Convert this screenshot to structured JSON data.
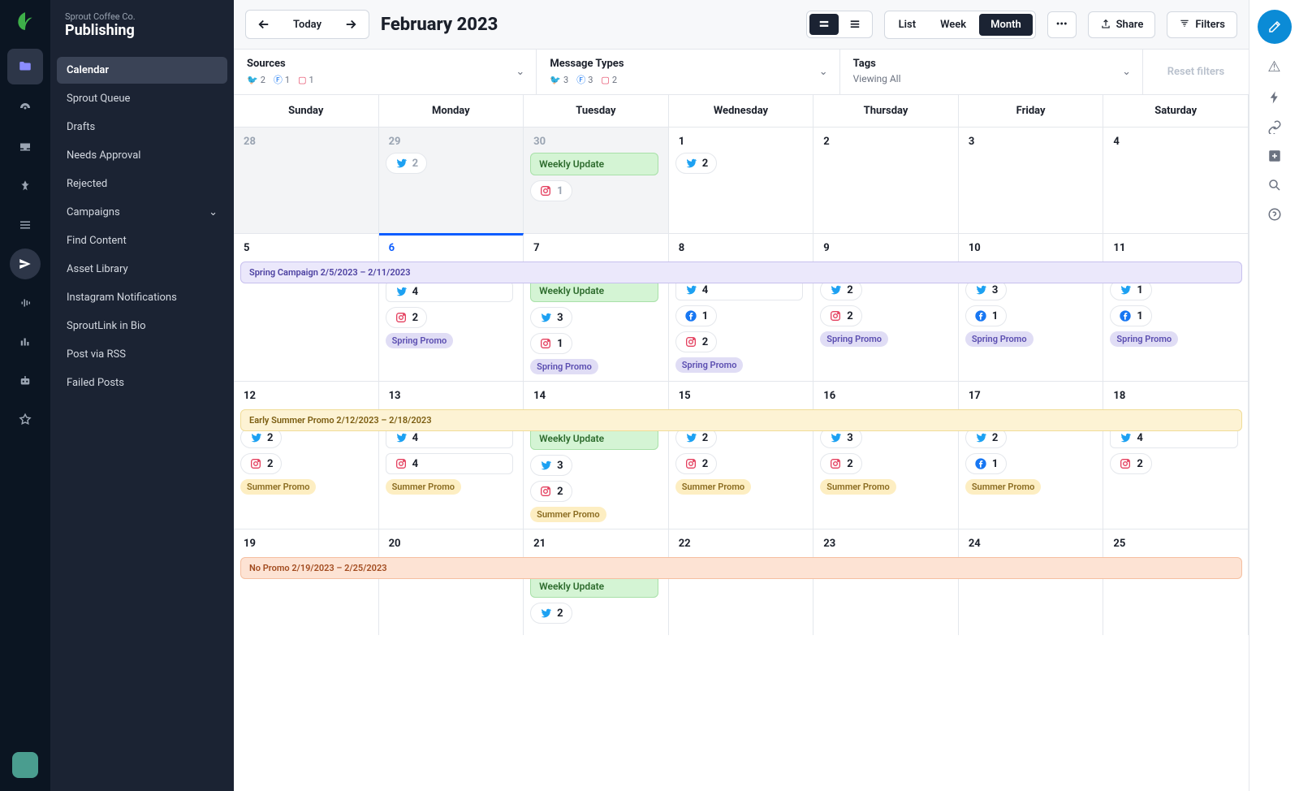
{
  "org": {
    "name": "Sprout Coffee Co.",
    "section": "Publishing"
  },
  "sidebar": {
    "items": [
      {
        "label": "Calendar",
        "active": true
      },
      {
        "label": "Sprout Queue"
      },
      {
        "label": "Drafts"
      },
      {
        "label": "Needs Approval"
      },
      {
        "label": "Rejected"
      },
      {
        "label": "Campaigns",
        "chevron": true
      },
      {
        "label": "Find Content"
      },
      {
        "label": "Asset Library"
      },
      {
        "label": "Instagram Notifications"
      },
      {
        "label": "SproutLink in Bio"
      },
      {
        "label": "Post via RSS"
      },
      {
        "label": "Failed Posts"
      }
    ]
  },
  "topbar": {
    "today": "Today",
    "title": "February 2023",
    "views": {
      "list": "List",
      "week": "Week",
      "month": "Month"
    },
    "share": "Share",
    "filters": "Filters"
  },
  "filters": {
    "sources": {
      "title": "Sources",
      "tw": "2",
      "fb": "1",
      "ig": "1"
    },
    "types": {
      "title": "Message Types",
      "tw": "3",
      "fb": "3",
      "ig": "2"
    },
    "tags": {
      "title": "Tags",
      "sub": "Viewing All"
    },
    "reset": "Reset filters"
  },
  "dow": [
    "Sunday",
    "Monday",
    "Tuesday",
    "Wednesday",
    "Thursday",
    "Friday",
    "Saturday"
  ],
  "labels": {
    "weekly": "Weekly Update",
    "spring": "Spring Promo",
    "summer": "Summer Promo"
  },
  "banners": {
    "w1": "Spring Campaign 2/5/2023 – 2/11/2023",
    "w2": "Early Summer Promo 2/12/2023 – 2/18/2023",
    "w3": "No Promo 2/19/2023 – 2/25/2023"
  },
  "weeks": [
    {
      "banner": null,
      "days": [
        {
          "num": "28",
          "prev": true
        },
        {
          "num": "29",
          "prev": true,
          "items": [
            {
              "t": "chip",
              "n": "tw",
              "v": "2"
            }
          ]
        },
        {
          "num": "30",
          "prev": true,
          "items": [
            {
              "t": "pill",
              "k": "weekly"
            },
            {
              "t": "chip",
              "n": "ig",
              "v": "1"
            }
          ]
        },
        {
          "num": "1",
          "items": [
            {
              "t": "chip",
              "n": "tw",
              "v": "2"
            }
          ]
        },
        {
          "num": "2"
        },
        {
          "num": "3"
        },
        {
          "num": "4"
        }
      ]
    },
    {
      "banner": "w1",
      "bclass": "purple",
      "days": [
        {
          "num": "5"
        },
        {
          "num": "6",
          "today": true,
          "items": [
            {
              "t": "chip",
              "n": "tw",
              "v": "4",
              "wide": true
            },
            {
              "t": "chip",
              "n": "ig",
              "v": "2"
            },
            {
              "t": "tag",
              "c": "purple",
              "k": "spring"
            }
          ]
        },
        {
          "num": "7",
          "items": [
            {
              "t": "pill",
              "k": "weekly"
            },
            {
              "t": "chip",
              "n": "tw",
              "v": "3"
            },
            {
              "t": "chip",
              "n": "ig",
              "v": "1"
            },
            {
              "t": "tag",
              "c": "purple",
              "k": "spring"
            }
          ]
        },
        {
          "num": "8",
          "items": [
            {
              "t": "chip",
              "n": "tw",
              "v": "4",
              "wide": true
            },
            {
              "t": "chip",
              "n": "fb",
              "v": "1"
            },
            {
              "t": "chip",
              "n": "ig",
              "v": "2"
            },
            {
              "t": "tag",
              "c": "purple",
              "k": "spring"
            }
          ]
        },
        {
          "num": "9",
          "items": [
            {
              "t": "chip",
              "n": "tw",
              "v": "2"
            },
            {
              "t": "chip",
              "n": "ig",
              "v": "2"
            },
            {
              "t": "tag",
              "c": "purple",
              "k": "spring"
            }
          ]
        },
        {
          "num": "10",
          "items": [
            {
              "t": "chip",
              "n": "tw",
              "v": "3"
            },
            {
              "t": "chip",
              "n": "fb",
              "v": "1"
            },
            {
              "t": "tag",
              "c": "purple",
              "k": "spring"
            }
          ]
        },
        {
          "num": "11",
          "items": [
            {
              "t": "chip",
              "n": "tw",
              "v": "1"
            },
            {
              "t": "chip",
              "n": "fb",
              "v": "1"
            },
            {
              "t": "tag",
              "c": "purple",
              "k": "spring"
            }
          ]
        }
      ]
    },
    {
      "banner": "w2",
      "bclass": "yellow",
      "days": [
        {
          "num": "12",
          "items": [
            {
              "t": "chip",
              "n": "tw",
              "v": "2"
            },
            {
              "t": "chip",
              "n": "ig",
              "v": "2"
            },
            {
              "t": "tag",
              "c": "yellow",
              "k": "summer"
            }
          ]
        },
        {
          "num": "13",
          "items": [
            {
              "t": "chip",
              "n": "tw",
              "v": "4",
              "wide": true
            },
            {
              "t": "chip",
              "n": "ig",
              "v": "4",
              "wide": true
            },
            {
              "t": "tag",
              "c": "yellow",
              "k": "summer"
            }
          ]
        },
        {
          "num": "14",
          "items": [
            {
              "t": "pill",
              "k": "weekly"
            },
            {
              "t": "chip",
              "n": "tw",
              "v": "3"
            },
            {
              "t": "chip",
              "n": "ig",
              "v": "2"
            },
            {
              "t": "tag",
              "c": "yellow",
              "k": "summer"
            }
          ]
        },
        {
          "num": "15",
          "items": [
            {
              "t": "chip",
              "n": "tw",
              "v": "2"
            },
            {
              "t": "chip",
              "n": "ig",
              "v": "2"
            },
            {
              "t": "tag",
              "c": "yellow",
              "k": "summer"
            }
          ]
        },
        {
          "num": "16",
          "items": [
            {
              "t": "chip",
              "n": "tw",
              "v": "3"
            },
            {
              "t": "chip",
              "n": "ig",
              "v": "2"
            },
            {
              "t": "tag",
              "c": "yellow",
              "k": "summer"
            }
          ]
        },
        {
          "num": "17",
          "items": [
            {
              "t": "chip",
              "n": "tw",
              "v": "2"
            },
            {
              "t": "chip",
              "n": "fb",
              "v": "1"
            },
            {
              "t": "tag",
              "c": "yellow",
              "k": "summer"
            }
          ]
        },
        {
          "num": "18",
          "items": [
            {
              "t": "chip",
              "n": "tw",
              "v": "4",
              "wide": true
            },
            {
              "t": "chip",
              "n": "ig",
              "v": "2"
            }
          ]
        }
      ]
    },
    {
      "banner": "w3",
      "bclass": "orange",
      "days": [
        {
          "num": "19"
        },
        {
          "num": "20"
        },
        {
          "num": "21",
          "items": [
            {
              "t": "pill",
              "k": "weekly"
            },
            {
              "t": "chip",
              "n": "tw",
              "v": "2"
            }
          ]
        },
        {
          "num": "22"
        },
        {
          "num": "23"
        },
        {
          "num": "24"
        },
        {
          "num": "25"
        }
      ]
    }
  ]
}
